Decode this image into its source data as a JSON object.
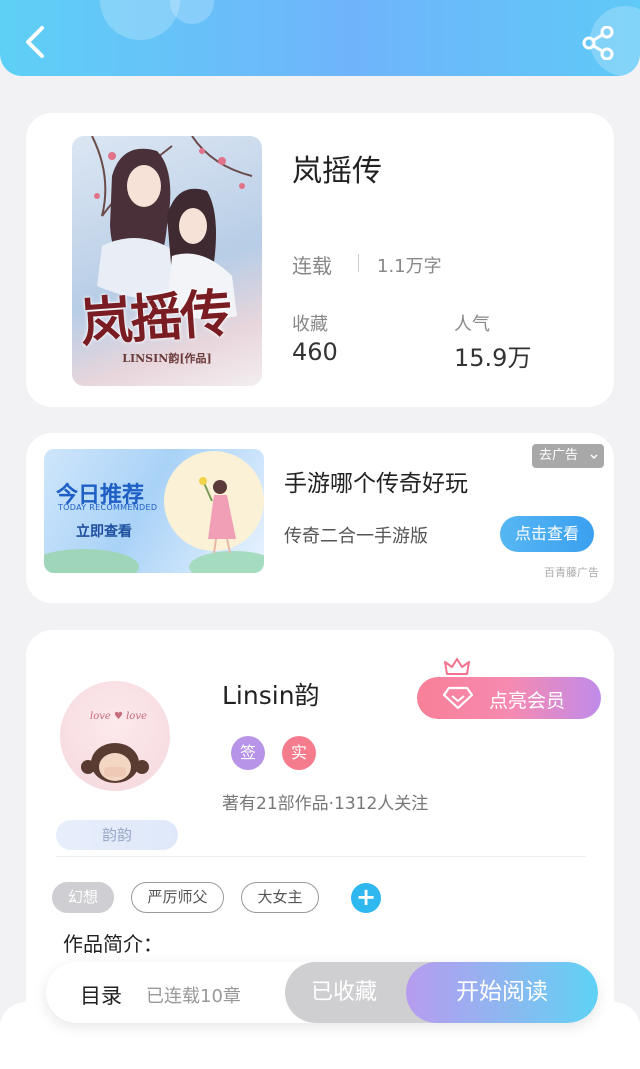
{
  "header": {
    "back_icon": "chevron-left-icon",
    "share_icon": "share-icon"
  },
  "book": {
    "cover_title": "岚摇传",
    "cover_author": "LINSIN韵[作品]",
    "title": "岚摇传",
    "status": "连载",
    "word_count": "1.1万字",
    "collect_label": "收藏",
    "collect_value": "460",
    "popularity_label": "人气",
    "popularity_value": "15.9万"
  },
  "ad": {
    "image_title": "今日推荐",
    "image_subtitle": "TODAY RECOMMENDED",
    "image_button": "立即查看",
    "remove_label": "去广告",
    "title": "手游哪个传奇好玩",
    "description": "传奇二合一手游版",
    "cta": "点击查看",
    "source": "百青藤广告"
  },
  "author": {
    "name": "Linsin韵",
    "avatar_text": "love ♥ love",
    "name_tag": "韵韵",
    "vip_button": "点亮会员",
    "badges": [
      {
        "label": "签",
        "color": "#b794e8"
      },
      {
        "label": "实",
        "color": "#f47c8c"
      }
    ],
    "meta": "著有21部作品·1312人关注"
  },
  "tags": [
    {
      "label": "幻想",
      "style": "filled"
    },
    {
      "label": "严厉师父",
      "style": "outline"
    },
    {
      "label": "大女主",
      "style": "outline"
    }
  ],
  "intro_label": "作品简介：",
  "bottom": {
    "toc_label": "目录",
    "toc_status": "已连载10章",
    "collected_label": "已收藏",
    "read_label": "开始阅读"
  },
  "colors": {
    "header_gradient_start": "#5ed0f6",
    "header_gradient_end": "#6fb4fb",
    "accent_blue": "#2fb7ef",
    "vip_pink": "#f87f98",
    "vip_purple": "#c08bea"
  }
}
